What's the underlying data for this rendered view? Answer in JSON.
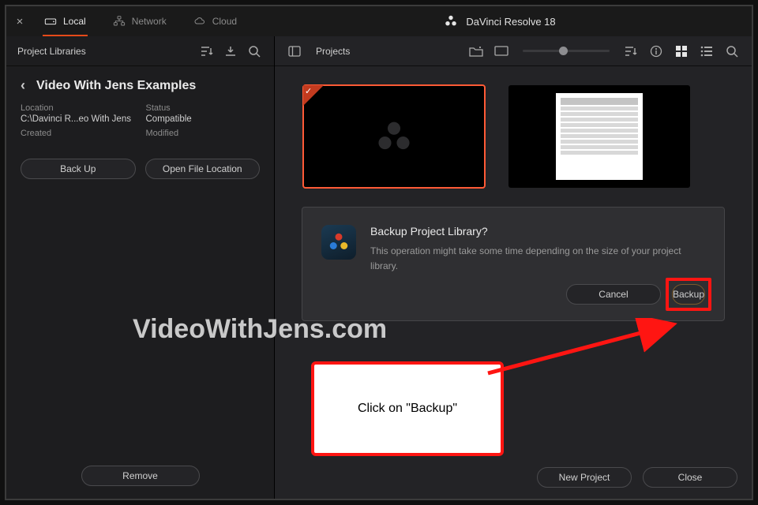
{
  "tabs": {
    "local": "Local",
    "network": "Network",
    "cloud": "Cloud"
  },
  "app_title": "DaVinci Resolve 18",
  "left_header": {
    "title": "Project Libraries"
  },
  "library": {
    "name": "Video With Jens Examples",
    "meta": {
      "location_k": "Location",
      "location_v": "C:\\Davinci R...eo With Jens",
      "status_k": "Status",
      "status_v": "Compatible",
      "created_k": "Created",
      "created_v": "",
      "modified_k": "Modified",
      "modified_v": ""
    },
    "backup_btn": "Back Up",
    "open_loc_btn": "Open File Location",
    "remove_btn": "Remove"
  },
  "right_header": {
    "title": "Projects"
  },
  "dialog": {
    "title": "Backup Project Library?",
    "msg": "This operation might take some time depending on the size of your project library.",
    "cancel": "Cancel",
    "backup": "Backup"
  },
  "footer": {
    "new_project": "New Project",
    "close": "Close"
  },
  "annotations": {
    "watermark": "VideoWithJens.com",
    "callout": "Click on \"Backup\""
  }
}
